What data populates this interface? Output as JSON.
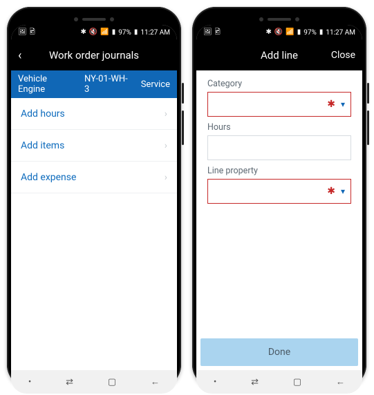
{
  "status": {
    "icons_left": [
      "🖼",
      "🖻"
    ],
    "right_text": "97%",
    "time": "11:27 AM"
  },
  "left_phone": {
    "title": "Work order journals",
    "context": {
      "entity": "Vehicle Engine",
      "ref": "NY-01-WH-3",
      "type": "Service"
    },
    "menu": [
      {
        "label": "Add hours"
      },
      {
        "label": "Add items"
      },
      {
        "label": "Add expense"
      }
    ]
  },
  "right_phone": {
    "title": "Add line",
    "close": "Close",
    "fields": {
      "category_label": "Category",
      "hours_label": "Hours",
      "lineprop_label": "Line property"
    },
    "done": "Done"
  },
  "nav_glyphs": {
    "dot": "•",
    "recents": "⇄",
    "home": "▢",
    "back": "←"
  }
}
